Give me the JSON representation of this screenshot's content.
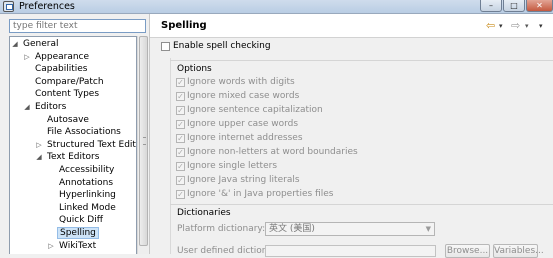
{
  "window": {
    "title": "Preferences",
    "minimize_glyph": "–",
    "maximize_glyph": "□",
    "close_glyph": "✕"
  },
  "filter": {
    "placeholder": "type filter text"
  },
  "tree": {
    "items": [
      {
        "label": "General",
        "expanded": true,
        "depth": 0
      },
      {
        "label": "Appearance",
        "expanded": false,
        "depth": 1
      },
      {
        "label": "Capabilities",
        "depth": 1
      },
      {
        "label": "Compare/Patch",
        "depth": 1
      },
      {
        "label": "Content Types",
        "depth": 1
      },
      {
        "label": "Editors",
        "expanded": true,
        "depth": 1
      },
      {
        "label": "Autosave",
        "depth": 2
      },
      {
        "label": "File Associations",
        "depth": 2
      },
      {
        "label": "Structured Text Editors",
        "expanded": false,
        "depth": 2
      },
      {
        "label": "Text Editors",
        "expanded": true,
        "depth": 2
      },
      {
        "label": "Accessibility",
        "depth": 3
      },
      {
        "label": "Annotations",
        "depth": 3
      },
      {
        "label": "Hyperlinking",
        "depth": 3
      },
      {
        "label": "Linked Mode",
        "depth": 3
      },
      {
        "label": "Quick Diff",
        "depth": 3
      },
      {
        "label": "Spelling",
        "depth": 3,
        "selected": true
      },
      {
        "label": "WikiText",
        "expanded": false,
        "depth": 3
      }
    ],
    "expanded_glyph": "◢",
    "collapsed_glyph": "▷"
  },
  "page": {
    "title": "Spelling",
    "history_back_glyph": "⇦",
    "history_fwd_glyph": "⇨",
    "dropdown_glyph": "▾",
    "enable_label": "Enable spell checking",
    "enable_checked": false,
    "options": {
      "label": "Options",
      "items": [
        {
          "label": "Ignore words with digits",
          "checked": true
        },
        {
          "label": "Ignore mixed case words",
          "checked": true
        },
        {
          "label": "Ignore sentence capitalization",
          "checked": true
        },
        {
          "label": "Ignore upper case words",
          "checked": true
        },
        {
          "label": "Ignore internet addresses",
          "checked": true
        },
        {
          "label": "Ignore non-letters at word boundaries",
          "checked": true
        },
        {
          "label": "Ignore single letters",
          "checked": true
        },
        {
          "label": "Ignore Java string literals",
          "checked": true
        },
        {
          "label": "Ignore '&' in Java properties files",
          "checked": true
        }
      ],
      "check_glyph": "✓"
    },
    "dictionaries": {
      "label": "Dictionaries",
      "platform_label": "Platform dictionary:",
      "platform_value": "英文 (美国)",
      "combo_arrow": "▼",
      "user_label": "User defined dictionary:",
      "browse_label": "Browse...",
      "variables_label": "Variables..."
    }
  },
  "colors": {
    "title_bar": "#c4d5e9",
    "selection": "#cde3f7",
    "back_arrow": "#c98c1c",
    "close_button": "#c4593f"
  }
}
